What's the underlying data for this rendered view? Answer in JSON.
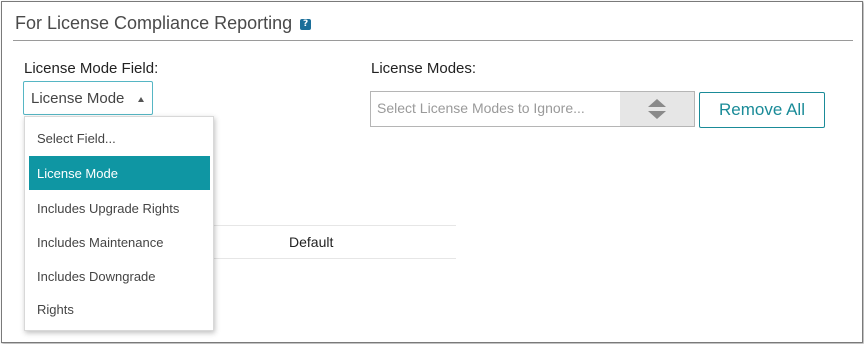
{
  "section": {
    "title": "For License Compliance Reporting",
    "help_icon": "?"
  },
  "license_mode_field": {
    "label": "License Mode Field:",
    "selected_value": "License Mode",
    "options": [
      "Select Field...",
      "License Mode",
      "Includes Upgrade Rights",
      "Includes Maintenance",
      "Includes Downgrade",
      "Rights"
    ],
    "selected_index": 1
  },
  "license_modes": {
    "label": "License Modes:",
    "placeholder": "Select License Modes to Ignore...",
    "remove_all_label": "Remove All"
  },
  "background_table": {
    "column_header": "Default"
  },
  "colors": {
    "accent": "#0f96a3",
    "button_border": "#1a8b98",
    "help_icon_bg": "#1a6e99"
  }
}
